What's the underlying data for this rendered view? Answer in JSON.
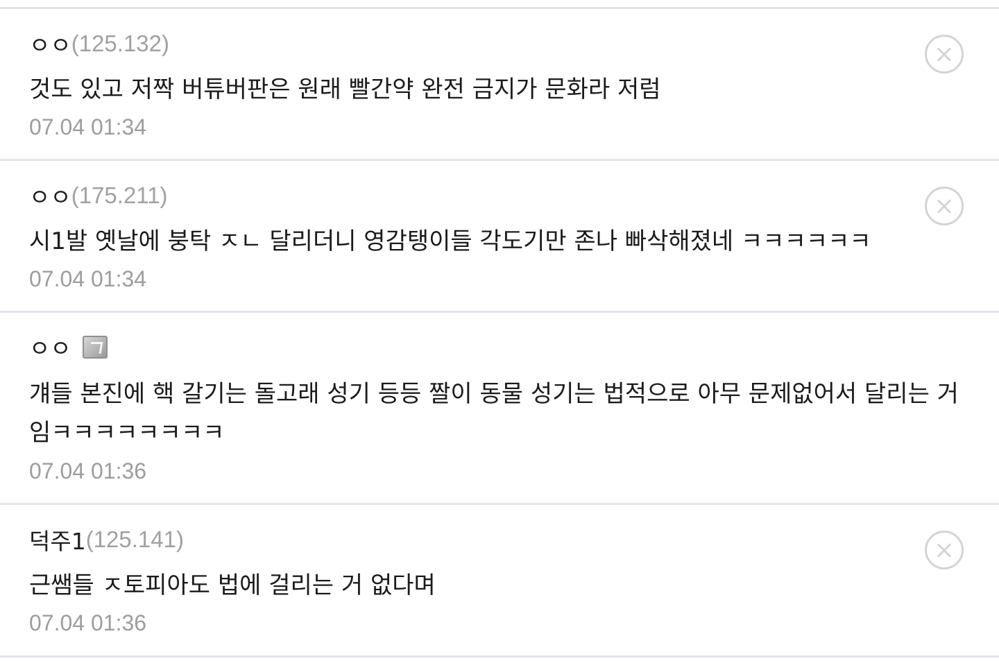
{
  "comments": [
    {
      "nickname": "ㅇㅇ",
      "ip": "(125.132)",
      "body": "것도 있고 저짝 버튜버판은 원래 빨간약 완전 금지가 문화라 저럼",
      "date": "07.04 01:34",
      "deletable": true
    },
    {
      "nickname": "ㅇㅇ",
      "ip": "(175.211)",
      "body": "시1발 옛날에 붕탁 ㅈㄴ 달리더니 영감탱이들 각도기만 존나 빠삭해졌네 ㅋㅋㅋㅋㅋㅋ",
      "date": "07.04 01:34",
      "deletable": true
    },
    {
      "nickname": "ㅇㅇ",
      "ip": "",
      "body": "걔들 본진에 핵 갈기는 돌고래 성기 등등 짤이 동물 성기는 법적으로 아무 문제없어서 달리는 거임ㅋㅋㅋㅋㅋㅋㅋㅋ",
      "date": "07.04 01:36",
      "deletable": false,
      "badge_icon": "fixed-nick-badge-icon"
    },
    {
      "nickname": "덕주1",
      "ip": "(125.141)",
      "body": "근쌤들 ㅈ토피아도 법에 걸리는 거 없다며",
      "date": "07.04 01:36",
      "deletable": true
    }
  ],
  "icons": {
    "delete": "circle-x-icon"
  },
  "colors": {
    "divider": "#e4e4ec",
    "meta_gray": "#9d9d9d",
    "text": "#1b1b1b",
    "delete_icon": "#d4d4d4"
  }
}
